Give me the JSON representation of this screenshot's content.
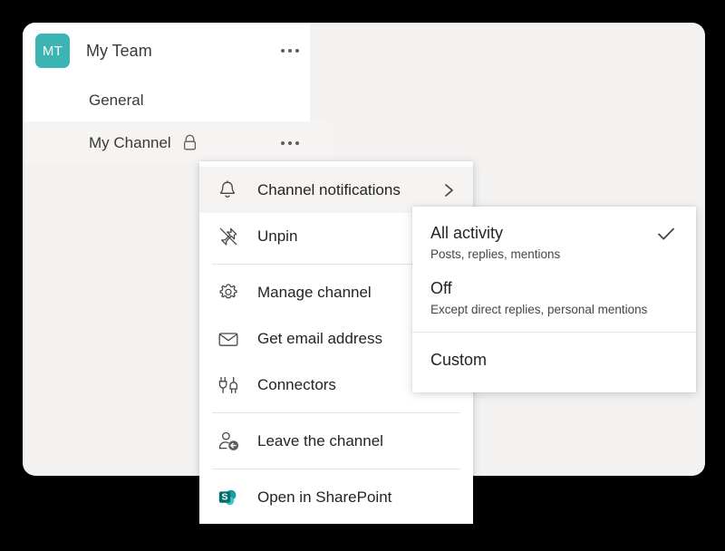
{
  "theme": {
    "page_background": "#000000",
    "card_background": "#f3f2f1",
    "panel_background": "#ffffff",
    "avatar_color": "#3cb4b4",
    "highlight": "#f5f4f3",
    "divider": "#e6e4e2",
    "text_primary": "#252423",
    "text_secondary": "#484644",
    "sharepoint_dark": "#036c70",
    "sharepoint_mid": "#1a9ba1",
    "sharepoint_light": "#37c6d0"
  },
  "rail": {
    "team": {
      "avatar_initials": "MT",
      "name": "My Team",
      "overflow_icon": "ellipsis-icon"
    },
    "channels": [
      {
        "name": "General",
        "private": false,
        "active": false,
        "overflow": false
      },
      {
        "name": "My Channel",
        "private": true,
        "active": true,
        "overflow": true,
        "lock_icon": "lock-icon"
      }
    ]
  },
  "context_menu": {
    "items": [
      {
        "label": "Channel notifications",
        "icon": "bell-icon",
        "submenu_icon": "chevron-right-icon",
        "has_submenu": true,
        "highlighted": true,
        "separator_after": false
      },
      {
        "label": "Unpin",
        "icon": "pin-off-icon",
        "has_submenu": false,
        "highlighted": false,
        "separator_after": true
      },
      {
        "label": "Manage channel",
        "icon": "gear-icon",
        "has_submenu": false,
        "highlighted": false,
        "separator_after": false
      },
      {
        "label": "Get email address",
        "icon": "envelope-icon",
        "has_submenu": false,
        "highlighted": false,
        "separator_after": false
      },
      {
        "label": "Connectors",
        "icon": "connectors-icon",
        "has_submenu": false,
        "highlighted": false,
        "separator_after": true
      },
      {
        "label": "Leave the channel",
        "icon": "leave-channel-icon",
        "has_submenu": false,
        "highlighted": false,
        "separator_after": true
      },
      {
        "label": "Open in SharePoint",
        "icon": "sharepoint-icon",
        "has_submenu": false,
        "highlighted": false,
        "separator_after": false
      }
    ]
  },
  "notifications_submenu": {
    "options": [
      {
        "title": "All activity",
        "subtitle": "Posts, replies, mentions",
        "selected": true,
        "check_icon": "checkmark-icon"
      },
      {
        "title": "Off",
        "subtitle": "Except direct replies, personal mentions",
        "selected": false
      },
      {
        "title": "Custom",
        "subtitle": "",
        "selected": false
      }
    ]
  }
}
